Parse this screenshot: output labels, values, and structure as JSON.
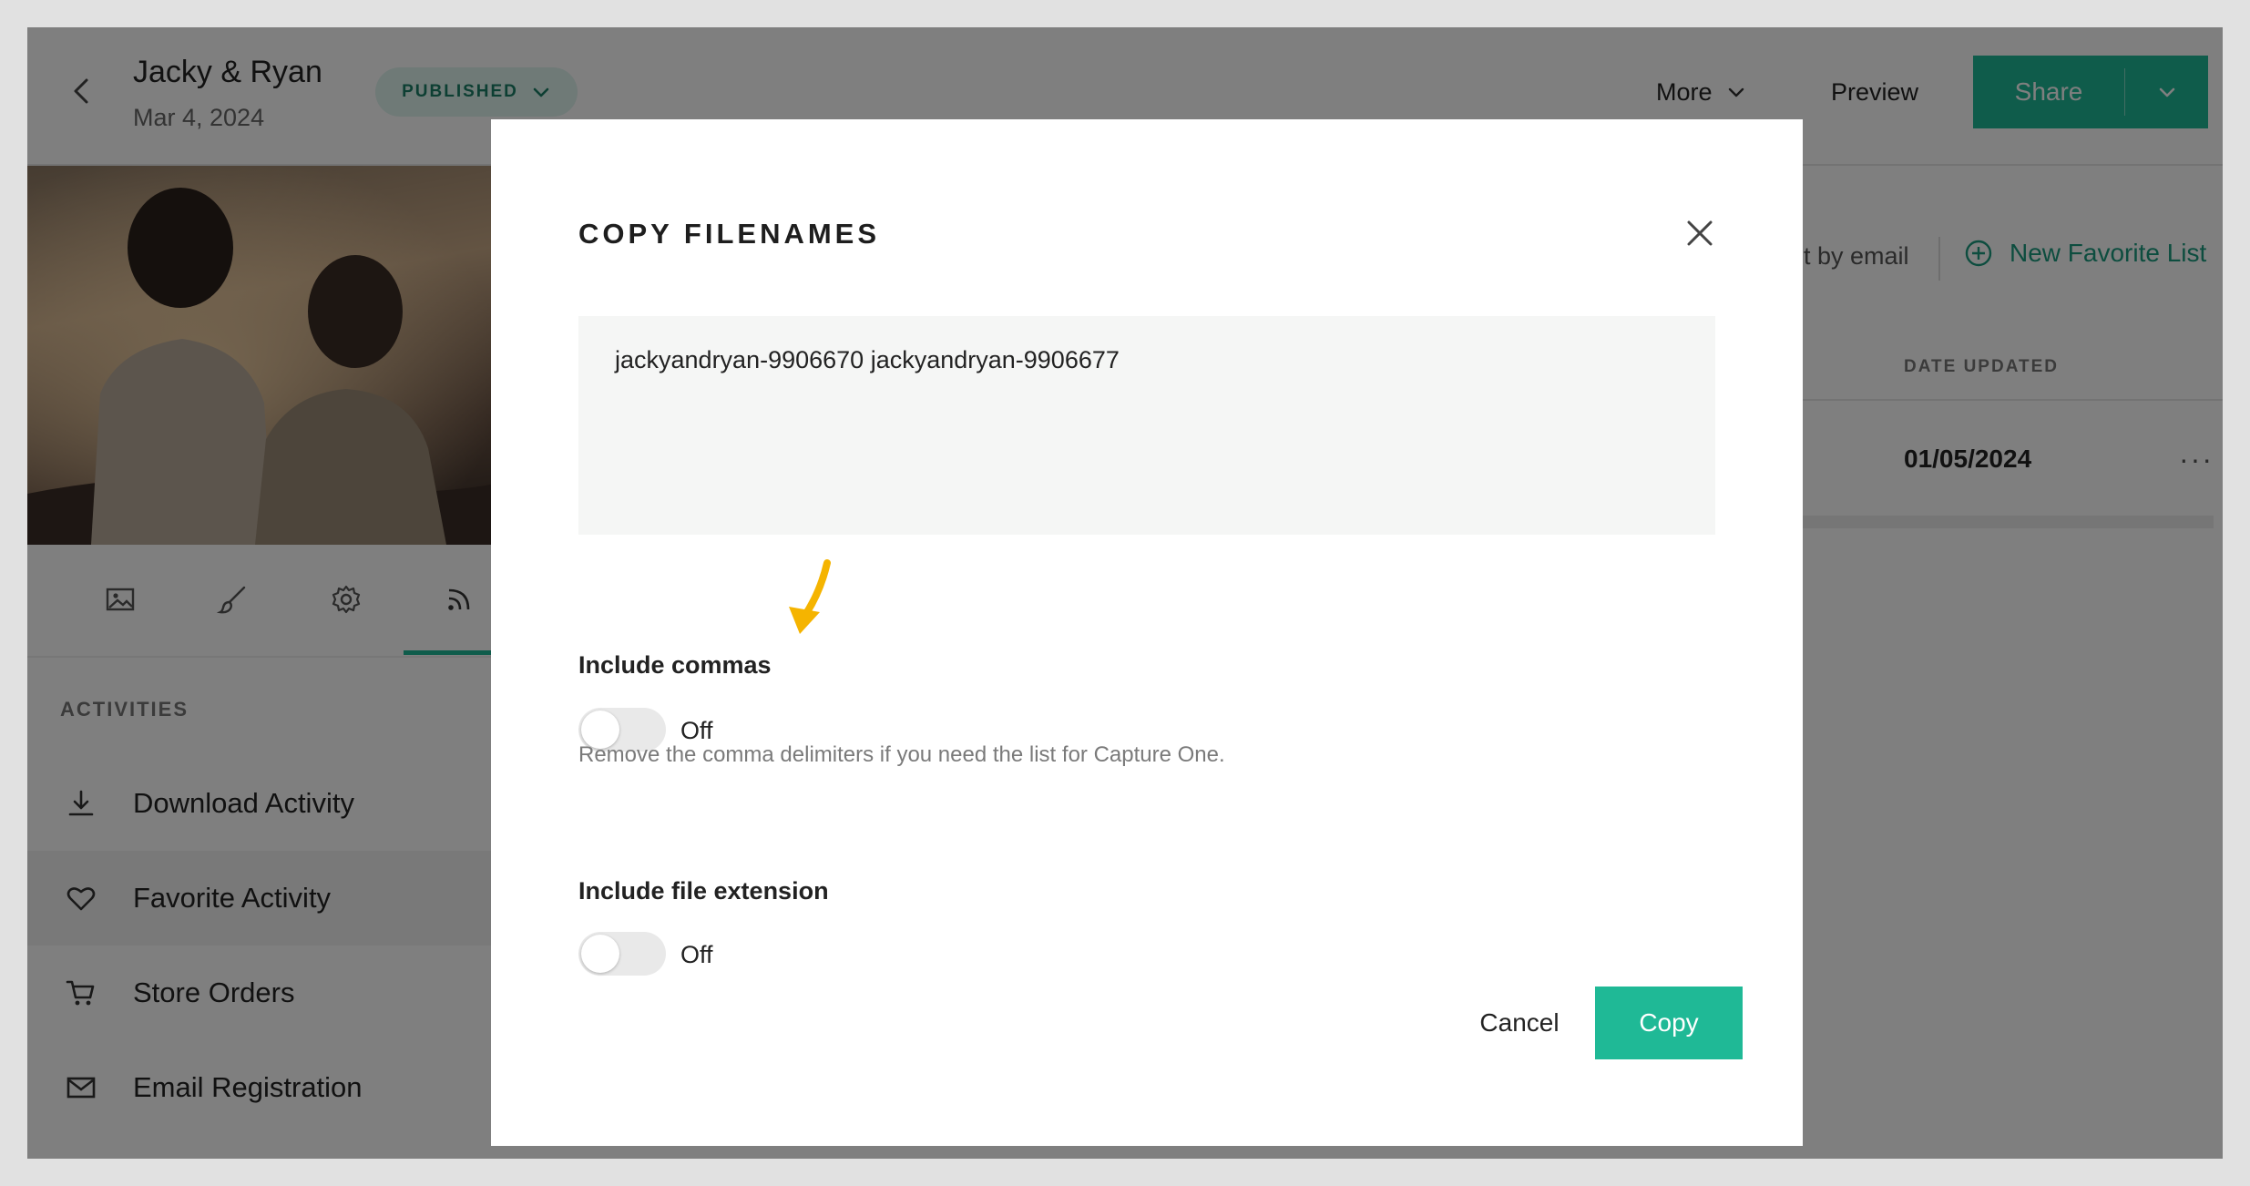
{
  "header": {
    "gallery_title": "Jacky & Ryan",
    "gallery_date": "Mar 4, 2024",
    "status": "PUBLISHED",
    "more_label": "More",
    "preview_label": "Preview",
    "share_label": "Share"
  },
  "sidebar": {
    "tabs": [
      "image-icon",
      "brush-icon",
      "gear-icon",
      "rss-icon"
    ],
    "active_tab": 3,
    "section_label": "ACTIVITIES",
    "items": [
      {
        "label": "Download Activity",
        "icon": "download-icon"
      },
      {
        "label": "Favorite Activity",
        "icon": "heart-icon",
        "active": true
      },
      {
        "label": "Store Orders",
        "icon": "cart-icon"
      },
      {
        "label": "Email Registration",
        "icon": "mail-icon"
      }
    ]
  },
  "content": {
    "email_action_partial": "t by email",
    "new_favorite_list": "New Favorite List",
    "column_header": "DATE UPDATED",
    "row_date": "01/05/2024",
    "row_more": "···"
  },
  "modal": {
    "title": "COPY FILENAMES",
    "filenames": "jackyandryan-9906670 jackyandryan-9906677",
    "include_commas": {
      "label": "Include commas",
      "state": "Off",
      "on": false
    },
    "commas_help": "Remove the comma delimiters if you need the list for Capture One.",
    "include_extension": {
      "label": "Include file extension",
      "state": "Off",
      "on": false
    },
    "cancel_label": "Cancel",
    "copy_label": "Copy"
  },
  "colors": {
    "accent": "#1fb996",
    "accent_text": "#1a9b7f",
    "annotation_arrow": "#f5b400"
  }
}
